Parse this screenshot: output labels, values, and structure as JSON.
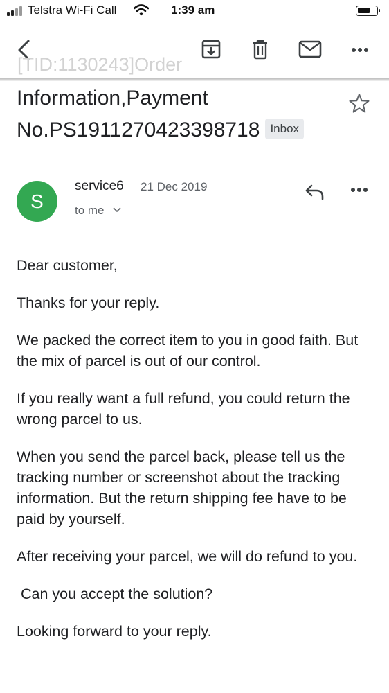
{
  "status_bar": {
    "carrier": "Telstra Wi-Fi Call",
    "time": "1:39 am",
    "icons": [
      "signal-icon",
      "wifi-icon",
      "battery-icon"
    ]
  },
  "toolbar": {
    "icons": [
      "back-arrow-icon",
      "archive-icon",
      "delete-icon",
      "mark-unread-icon",
      "more-icon"
    ],
    "scrolled_subject_fragment": "[TID:1130243]Order"
  },
  "email": {
    "subject_line1": "Information,Payment",
    "subject_line2": "No.PS1911270423398718",
    "label": "Inbox",
    "sender_initial": "S",
    "sender_name": "service6",
    "date": "21 Dec 2019",
    "recipient": "to me",
    "avatar_color": "#33a852",
    "body": [
      "Dear customer,",
      "Thanks for your reply.",
      "We packed the correct item to you in good faith. But the mix of parcel is out of our control.",
      "If you really want a full refund, you could return the wrong parcel to us.",
      "When you send the parcel back, please tell us the tracking number or screenshot about the tracking information. But the return shipping fee have to be paid by yourself.",
      "After receiving your parcel, we will do refund to you.",
      " Can you accept the solution?",
      "Looking forward to your reply."
    ]
  }
}
